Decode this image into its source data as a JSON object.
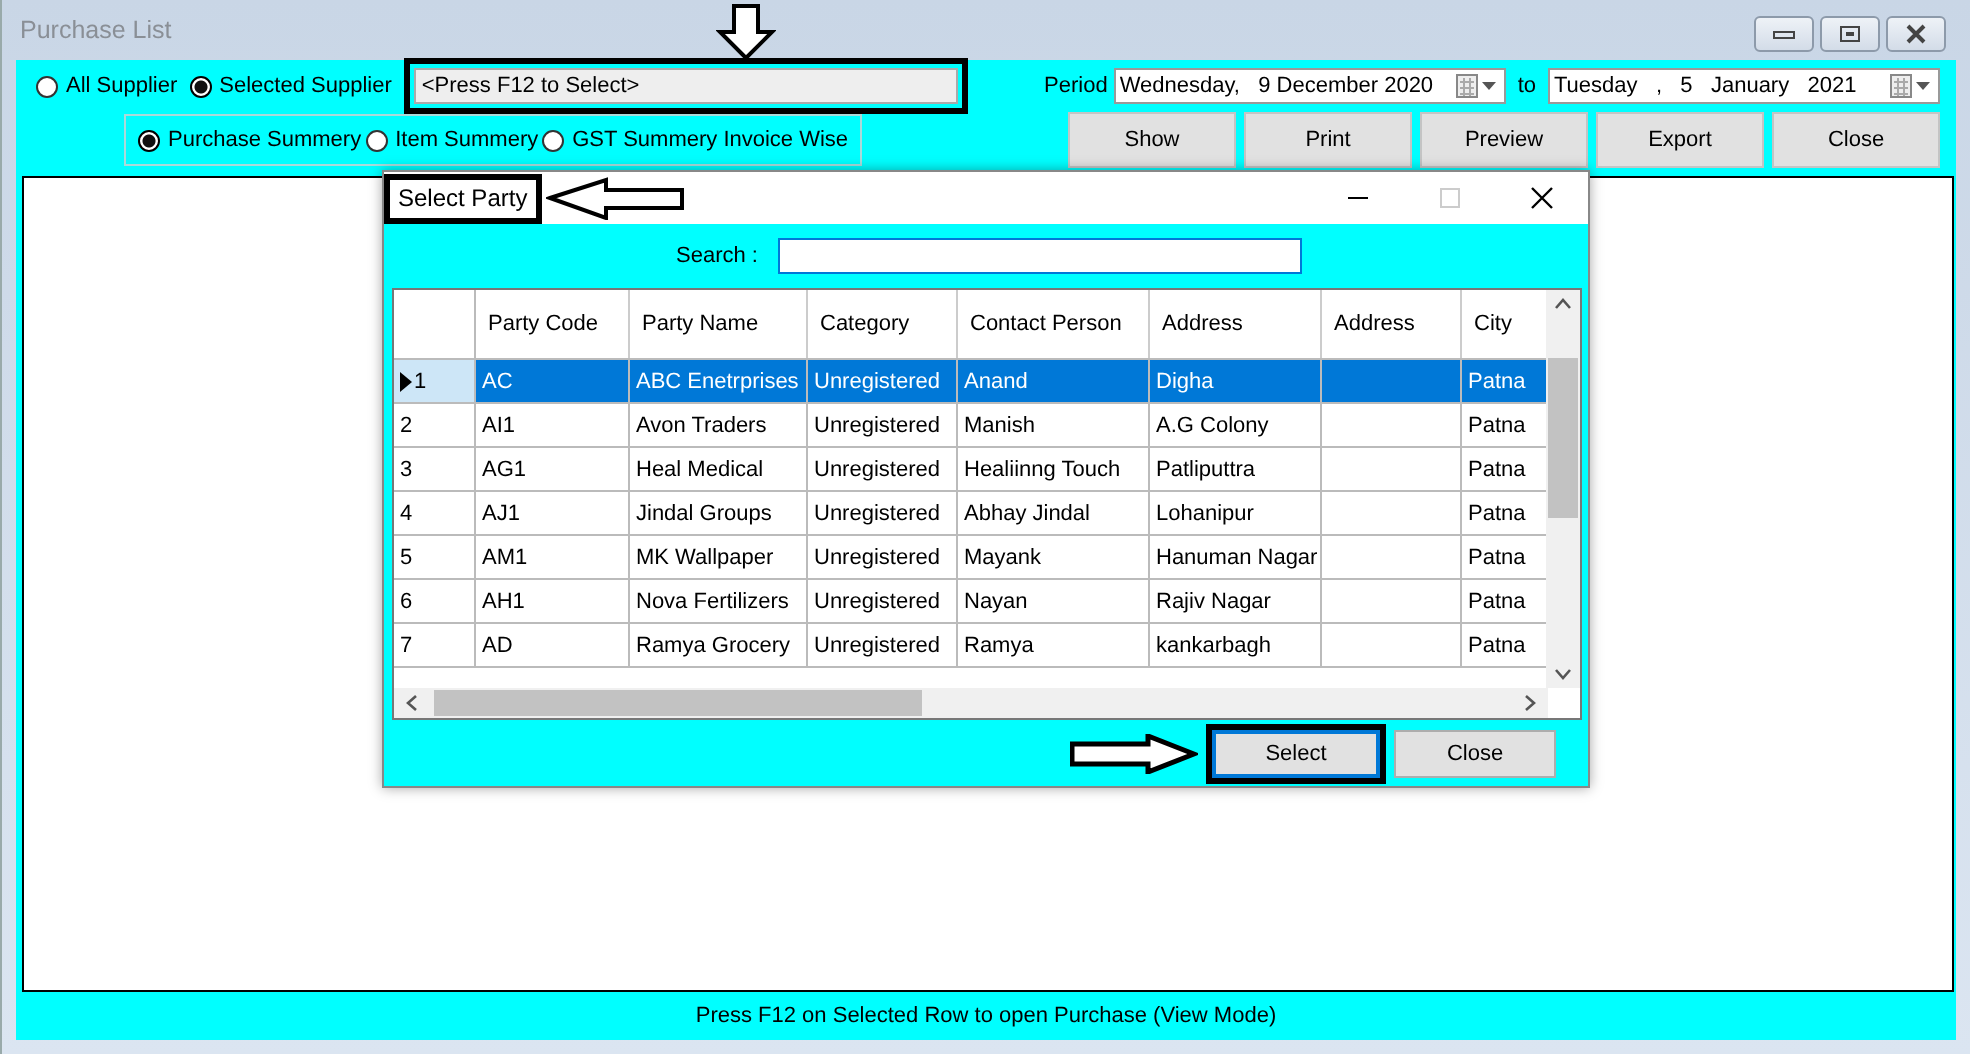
{
  "window": {
    "title": "Purchase List"
  },
  "supplier_options": [
    {
      "label": "All Supplier",
      "selected": false
    },
    {
      "label": "Selected Supplier",
      "selected": true
    }
  ],
  "supplier_field": {
    "value": "<Press F12 to Select>"
  },
  "period": {
    "label": "Period",
    "from": "Wednesday,   9 December 2020",
    "separator": "to",
    "to": "Tuesday   ,   5   January   2021"
  },
  "report_options": [
    {
      "label": "Purchase Summery",
      "selected": true
    },
    {
      "label": "Item Summery",
      "selected": false
    },
    {
      "label": "GST Summery Invoice Wise",
      "selected": false
    }
  ],
  "buttons": [
    "Show",
    "Print",
    "Preview",
    "Export",
    "Close"
  ],
  "dialog": {
    "title": "Select Party",
    "search": {
      "label": "Search :"
    },
    "columns": [
      "Party Code",
      "Party Name",
      "Category",
      "Contact Person",
      "Address",
      "Address",
      "City"
    ],
    "rows": [
      {
        "number": "1",
        "selected": true,
        "cells": [
          "AC",
          "ABC Enetrprises",
          "Unregistered",
          "Anand",
          "Digha",
          null,
          "Patna"
        ]
      },
      {
        "number": "2",
        "selected": false,
        "cells": [
          "AI1",
          "Avon Traders",
          "Unregistered",
          "Manish",
          "A.G Colony",
          null,
          "Patna"
        ]
      },
      {
        "number": "3",
        "selected": false,
        "cells": [
          "AG1",
          "Heal Medical",
          "Unregistered",
          "Healiinng Touch",
          "Patliputtra",
          null,
          "Patna"
        ]
      },
      {
        "number": "4",
        "selected": false,
        "cells": [
          "AJ1",
          "Jindal Groups",
          "Unregistered",
          "Abhay Jindal",
          "Lohanipur",
          null,
          "Patna"
        ]
      },
      {
        "number": "5",
        "selected": false,
        "cells": [
          "AM1",
          "MK Wallpaper",
          "Unregistered",
          "Mayank",
          "Hanuman Nagar",
          null,
          "Patna"
        ]
      },
      {
        "number": "6",
        "selected": false,
        "cells": [
          "AH1",
          "Nova Fertilizers",
          "Unregistered",
          "Nayan",
          "Rajiv Nagar",
          null,
          "Patna"
        ]
      },
      {
        "number": "7",
        "selected": false,
        "cells": [
          "AD",
          "Ramya Grocery",
          "Unregistered",
          "Ramya",
          "kankarbagh",
          null,
          "Patna"
        ]
      }
    ],
    "buttons": [
      "Select",
      "Close"
    ]
  },
  "status_bar": "Press F12 on Selected Row to open Purchase (View Mode)"
}
